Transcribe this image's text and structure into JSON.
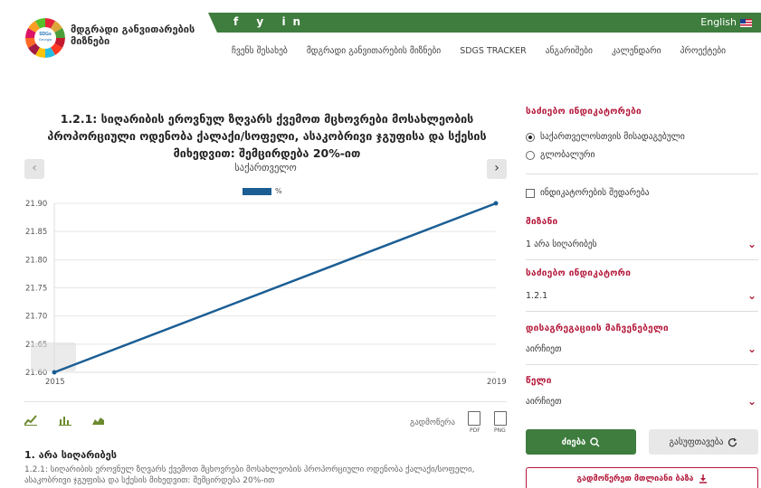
{
  "header": {
    "org_name_line1": "მდგრადი განვითარების",
    "org_name_line2": "მიზნები",
    "logo_text": "SDGs Georgia",
    "social": [
      "f",
      "y",
      "in"
    ],
    "language": "English",
    "nav": [
      "ჩვენს შესახებ",
      "მდგრადი განვითარების მიზნები",
      "SDGS TRACKER",
      "ანგარიშები",
      "კალენდარი",
      "პროექტები"
    ]
  },
  "main": {
    "title": "1.2.1: სიღარიბის ეროვნულ ზღვარს ქვემოთ მცხოვრები მოსახლეობის პროპორციული ოდენობა ქალაქი/სოფელი, ასაკობრივი ჯგუფისა და სქესის მიხედვით: შემცირდება 20%-ით",
    "country": "საქართველო",
    "prev_icon": "‹",
    "next_icon": "›",
    "export_label": "გადმოწერა",
    "export_pdf": "PDF",
    "export_png": "PNG",
    "subtitle": "1. არა სიღარიბეს",
    "subtitle_text": "1.2.1: სიღარიბის ეროვნულ ზღვარს ქვემოთ მცხოვრები მოსახლეობის პროპორციული ოდენობა ქალაქი/სოფელი, ასაკობრივი ჯგუფისა და სქესის მიხედვით: შემცირდება 20%-ით"
  },
  "chart_data": {
    "type": "line",
    "x": [
      2015,
      2019
    ],
    "series": [
      {
        "name": "%",
        "values": [
          21.6,
          21.9
        ],
        "color": "#1b5e94"
      }
    ],
    "y_ticks": [
      "21.60",
      "21.65",
      "21.70",
      "21.75",
      "21.80",
      "21.85",
      "21.90"
    ],
    "x_ticks": [
      "2015",
      "2019"
    ],
    "ylim": [
      21.6,
      21.9
    ],
    "xlim": [
      2015,
      2019
    ],
    "grid": true,
    "legend_position": "top-center",
    "title": "",
    "xlabel": "",
    "ylabel": ""
  },
  "sidebar": {
    "search_indicators_heading": "საძიებო ინდიკატორები",
    "radio_national": "საქართველოსთვის მისადაგებული",
    "radio_global": "გლობალური",
    "compare_label": "ინდიკატორების შედარება",
    "goal_heading": "მიზანი",
    "goal_value": "1 არა სიღარიბეს",
    "indicator_heading": "საძიებო ინდიკატორი",
    "indicator_value": "1.2.1",
    "disaggregation_heading": "დისაგრეგაციის მაჩვენებელი",
    "disaggregation_value": "აირჩიეთ",
    "year_heading": "წელი",
    "year_value": "აირჩიეთ",
    "search_label": "ძიება",
    "reset_label": "გასუფთავება",
    "download_label": "გადმოწერეთ მთლიანი ბაზა",
    "chevron": "⌄"
  },
  "colors": {
    "green": "#3e7d3e",
    "crimson": "#b4183b",
    "series": "#1b5e94"
  }
}
